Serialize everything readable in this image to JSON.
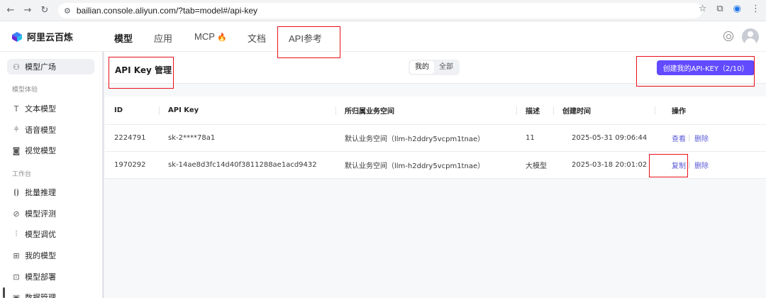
{
  "browser": {
    "url": "bailian.console.aliyun.com/?tab=model#/api-key"
  },
  "app": {
    "logo_text": "阿里云百炼",
    "nav_tabs": [
      {
        "label": "模型",
        "active": true
      },
      {
        "label": "应用",
        "active": false
      },
      {
        "label": "MCP",
        "active": false,
        "badge_icon": "fire-icon"
      },
      {
        "label": "文档",
        "active": false
      },
      {
        "label": "API参考",
        "active": false
      }
    ]
  },
  "sidebar": {
    "top_item": {
      "label": "模型广场",
      "icon": "sparkle-icon"
    },
    "sections": [
      {
        "title": "模型体验",
        "items": [
          {
            "label": "文本模型",
            "icon": "text-icon"
          },
          {
            "label": "语音模型",
            "icon": "audio-icon"
          },
          {
            "label": "视觉模型",
            "icon": "camera-icon"
          }
        ]
      },
      {
        "title": "工作台",
        "items": [
          {
            "label": "批量推理",
            "icon": "batch-icon"
          },
          {
            "label": "模型评测",
            "icon": "compass-icon"
          },
          {
            "label": "模型调优",
            "icon": "tune-icon"
          },
          {
            "label": "我的模型",
            "icon": "grid-icon"
          },
          {
            "label": "模型部署",
            "icon": "deploy-icon"
          },
          {
            "label": "数据管理",
            "icon": "data-icon"
          }
        ]
      }
    ]
  },
  "page": {
    "title": "API Key 管理",
    "filter": {
      "options": [
        "我的",
        "全部"
      ],
      "selected": "我的"
    },
    "create_button": "创建我的API-KEY（2/10）",
    "table": {
      "headers": [
        "ID",
        "API Key",
        "所归属业务空间",
        "描述",
        "创建时间",
        "操作"
      ],
      "rows": [
        {
          "id": "2224791",
          "api_key": "sk-2****78a1",
          "workspace": "默认业务空间（llm-h2ddry5vcpm1tnae）",
          "desc": "11",
          "created": "2025-05-31 09:06:44",
          "actions": [
            "查看",
            "删除"
          ]
        },
        {
          "id": "1970292",
          "api_key": "sk-14ae8d3fc14d40f3811288ae1acd9432",
          "workspace": "默认业务空间（llm-h2ddry5vcpm1tnae）",
          "desc": "大模型",
          "created": "2025-03-18 20:01:02",
          "actions": [
            "复制",
            "删除"
          ]
        }
      ]
    }
  },
  "colors": {
    "accent": "#624aff",
    "link": "#5b5bd6",
    "annotation_red": "#e8101a"
  }
}
